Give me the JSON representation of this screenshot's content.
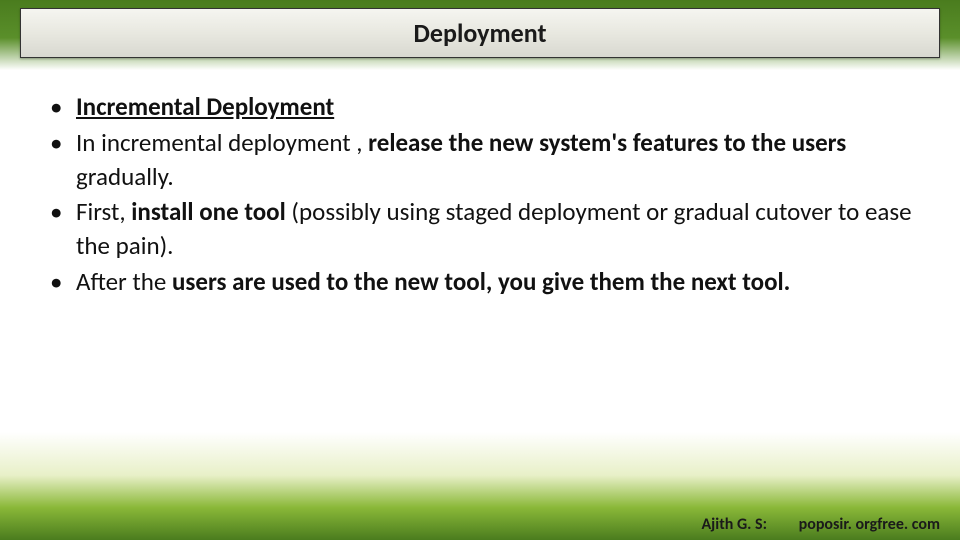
{
  "title": "Deployment",
  "bullets": {
    "b1": {
      "pre": " ",
      "heading": "Incremental Deployment"
    },
    "b2": {
      "pre": " In incremental deployment  , ",
      "bold1": "release the new system's features to the users",
      "rest": " gradually."
    },
    "b3": {
      "pre": " First, ",
      "bold1": "install one tool",
      "rest": " (possibly using staged deployment or gradual cutover to ease the pain)."
    },
    "b4": {
      "pre": " After the ",
      "bold1": "users are used to the new tool, you give them the next tool.",
      "rest": ""
    }
  },
  "footer": {
    "author": "Ajith G. S:",
    "site": "poposir. orgfree. com"
  }
}
